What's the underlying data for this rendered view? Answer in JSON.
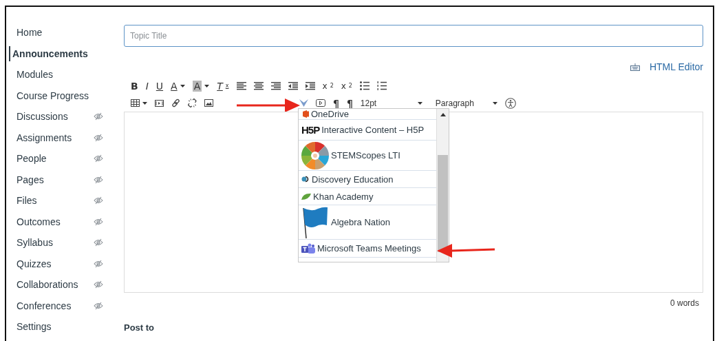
{
  "sidebar": {
    "items": [
      {
        "label": "Home",
        "selected": false,
        "hidden": false
      },
      {
        "label": "Announcements",
        "selected": true,
        "hidden": false
      },
      {
        "label": "Modules",
        "selected": false,
        "hidden": false
      },
      {
        "label": "Course Progress",
        "selected": false,
        "hidden": false
      },
      {
        "label": "Discussions",
        "selected": false,
        "hidden": true
      },
      {
        "label": "Assignments",
        "selected": false,
        "hidden": true
      },
      {
        "label": "People",
        "selected": false,
        "hidden": true
      },
      {
        "label": "Pages",
        "selected": false,
        "hidden": true
      },
      {
        "label": "Files",
        "selected": false,
        "hidden": true
      },
      {
        "label": "Outcomes",
        "selected": false,
        "hidden": true
      },
      {
        "label": "Syllabus",
        "selected": false,
        "hidden": true
      },
      {
        "label": "Quizzes",
        "selected": false,
        "hidden": true
      },
      {
        "label": "Collaborations",
        "selected": false,
        "hidden": true
      },
      {
        "label": "Conferences",
        "selected": false,
        "hidden": true
      },
      {
        "label": "Settings",
        "selected": false,
        "hidden": false
      }
    ]
  },
  "topic_title": {
    "placeholder": "Topic Title"
  },
  "html_editor_link": "HTML Editor",
  "toolbar": {
    "row_1": [
      {
        "kind": "bold",
        "text": "B"
      },
      {
        "kind": "italic",
        "text": "I"
      },
      {
        "kind": "underline",
        "text": "U"
      },
      {
        "kind": "text-color",
        "text": "A"
      },
      {
        "kind": "background-color",
        "text": "A"
      },
      {
        "kind": "clear-format",
        "text": "T",
        "sub": "x"
      },
      {
        "kind": "align-left"
      },
      {
        "kind": "align-center"
      },
      {
        "kind": "align-right"
      },
      {
        "kind": "outdent"
      },
      {
        "kind": "indent"
      },
      {
        "kind": "script",
        "text": "x",
        "sup": "2"
      },
      {
        "kind": "script",
        "text": "x",
        "sub": "2"
      },
      {
        "kind": "bullet-list"
      },
      {
        "kind": "numbered-list"
      }
    ],
    "row_2": [
      {
        "kind": "table"
      },
      {
        "kind": "media"
      },
      {
        "kind": "link"
      },
      {
        "kind": "unlink"
      },
      {
        "kind": "image"
      },
      {
        "kind": "blank"
      },
      {
        "kind": "blank"
      },
      {
        "kind": "blank"
      },
      {
        "kind": "apps"
      },
      {
        "kind": "play"
      },
      {
        "kind": "ltr",
        "text": "¶"
      },
      {
        "kind": "rtl",
        "text": "¶"
      },
      {
        "kind": "select",
        "text": "12pt"
      },
      {
        "kind": "select",
        "text": "Paragraph"
      },
      {
        "kind": "accessibility"
      }
    ]
  },
  "apps_menu": {
    "items": [
      {
        "kind": "onedrive",
        "label": "OneDrive"
      },
      {
        "kind": "h5p",
        "logo_text": "H5P",
        "label": "Interactive Content – H5P"
      },
      {
        "kind": "stemscopes",
        "label": "STEMScopes LTI"
      },
      {
        "kind": "discovery",
        "label": "Discovery Education"
      },
      {
        "kind": "khan",
        "label": "Khan Academy"
      },
      {
        "kind": "flag",
        "label": "Algebra Nation"
      },
      {
        "kind": "teams",
        "label": "Microsoft Teams Meetings"
      }
    ]
  },
  "word_count": "0 words",
  "post_to": "Post to"
}
